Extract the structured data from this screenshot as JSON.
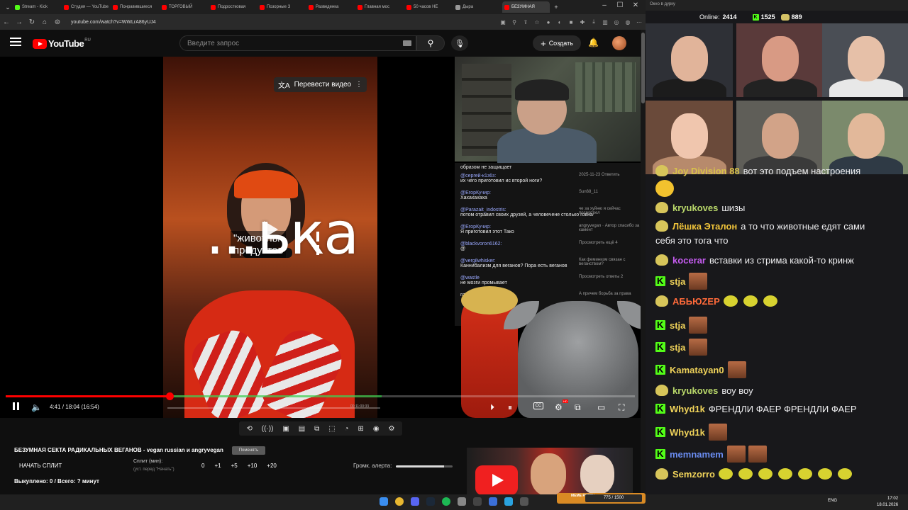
{
  "browser": {
    "tabs": [
      {
        "label": "Stream - Kick",
        "color": "#53fc18",
        "active": false
      },
      {
        "label": "Студия — YouTube",
        "color": "#ff0000",
        "active": false
      },
      {
        "label": "Понравившиеся",
        "color": "#ff0000",
        "active": false
      },
      {
        "label": "ТОРГОВЫЙ",
        "color": "#ff0000",
        "active": false
      },
      {
        "label": "Подростковая",
        "color": "#ff0000",
        "active": false
      },
      {
        "label": "Позорные З",
        "color": "#ff0000",
        "active": false
      },
      {
        "label": "Разведенка",
        "color": "#ff0000",
        "active": false
      },
      {
        "label": "Главная мос",
        "color": "#ff0000",
        "active": false
      },
      {
        "label": "50 часов НЕ",
        "color": "#ff0000",
        "active": false
      },
      {
        "label": "Дыра",
        "color": "#999999",
        "active": false
      },
      {
        "label": "БЕЗУМНАЯ",
        "color": "#ff0000",
        "active": true
      }
    ],
    "url": "youtube.com/watch?v=WWLrA86yUJ4"
  },
  "youtube": {
    "logo_text": "YouTube",
    "region": "RU",
    "search_placeholder": "Введите запрос",
    "create_label": "Создать"
  },
  "video": {
    "translate_label": "Перевести видео",
    "big_caption": "...ька",
    "sub_caption_1": "\"животны",
    "sub_caption_2": "продуктов",
    "time": "4:41 / 18:04 (16:54)",
    "mini_time": "00:11:00:33",
    "progress": 0.26,
    "comments": [
      {
        "author": "",
        "text": "образом не защищает",
        "reply": ""
      },
      {
        "author": "@сергей-к1з6з:",
        "text": "их чего приготовил ис второй ноги?",
        "reply": "2025-11-23 Ответить"
      },
      {
        "author": "@ЕгорКучир:",
        "text": "Хахахахаха",
        "reply": "Sun68_11"
      },
      {
        "author": "@Parazait_indostris:",
        "text": "потом отравил своих друзей, а человечене столько говна",
        "reply": "че за хуйню я сейчас посмотрел"
      },
      {
        "author": "@ЕгорКучир:",
        "text": "Я приготовил этот Тако",
        "reply": "angryvegan · Автор спасибо за камент"
      },
      {
        "author": "@blackvoron6162:",
        "text": "@",
        "reply": "Просмотреть ещё 4"
      },
      {
        "author": "@vergilwhisker:",
        "text": "Каннибализм для веганов? Пора есть веганов",
        "reply": "Как феминизм связан с веганством?"
      },
      {
        "author": "@wastle",
        "text": "не мозги промывает",
        "reply": "Просмотреть ответы 2"
      },
      {
        "author": "",
        "text": "гласи",
        "reply": "А причем борьба за права"
      }
    ]
  },
  "below_video": {
    "title": "БЕЗУМНАЯ СЕКТА РАДИКАЛЬНЫХ ВЕГАНОВ - vegan russian и angryvegan",
    "title_tag": "Поменять",
    "split_button": "НАЧАТЬ СПЛИТ",
    "split_label": "Сплит (мин):",
    "split_sub": "(уст. перед \"Начать\")",
    "split_values": [
      "0",
      "+1",
      "+5",
      "+10",
      "+20"
    ],
    "alert_label": "Громк. алерта:",
    "alert_volume": 0.85,
    "bought": "Выкуплено: 0 / Всего: ? минут"
  },
  "chat_window": {
    "title": "Окно в дурку",
    "online_label": "Online:",
    "online_count": "2414",
    "kick_count": "1525",
    "coin_count": "889",
    "messages": [
      {
        "user": "Joy Division 88",
        "color": "#d8c24a",
        "text": "вот это подъем настроения",
        "badge": "pepe",
        "emotes": 0
      },
      {
        "user": "kryukoves",
        "color": "#b9d86a",
        "text": "шизы",
        "badge": "pepe",
        "emotes": 0
      },
      {
        "user": "Лёшка Эталон",
        "color": "#f0c43a",
        "text": "а то что животные едят сами",
        "badge": "pepe",
        "emotes": 0
      },
      {
        "user": "",
        "color": "#ffffff",
        "text": "себя это тога что",
        "badge": "",
        "emotes": 0
      },
      {
        "user": "kocerar",
        "color": "#c55cf0",
        "text": "вставки из стрима какой-то кринж",
        "badge": "pepe",
        "emotes": 0
      },
      {
        "user": "stja",
        "color": "#f0d35a",
        "text": "",
        "badge": "kick",
        "emotes": 1
      },
      {
        "user": "АБЬЮZEP",
        "color": "#ff6a3a",
        "text": "",
        "badge": "pepe",
        "emotes": 0
      },
      {
        "user": "stja",
        "color": "#f0d35a",
        "text": "",
        "badge": "kick",
        "emotes": 1
      },
      {
        "user": "stja",
        "color": "#f0d35a",
        "text": "",
        "badge": "kick",
        "emotes": 1
      },
      {
        "user": "Kamatayan0",
        "color": "#f0d35a",
        "text": "",
        "badge": "kick",
        "emotes": 1
      },
      {
        "user": "kryukoves",
        "color": "#b9d86a",
        "text": "воу воу",
        "badge": "pepe",
        "emotes": 0
      },
      {
        "user": "Whyd1k",
        "color": "#f0d35a",
        "text": "ФРЕНДЛИ ФАЕР ФРЕНДЛИ ФАЕР",
        "badge": "kick",
        "emotes": 0
      },
      {
        "user": "Whyd1k",
        "color": "#f0d35a",
        "text": "",
        "badge": "kick",
        "emotes": 1
      },
      {
        "user": "memnamem",
        "color": "#6a8cf0",
        "text": "",
        "badge": "kick",
        "emotes": 2
      },
      {
        "user": "Semzorro",
        "color": "#f0d35a",
        "text": "",
        "badge": "pepe",
        "emotes": 0
      }
    ]
  },
  "taskbar": {
    "lang": "ENG",
    "time": "17:02",
    "date": "18.01.2026",
    "meme_label": "MEME PARTY",
    "meme_progress": "775 / 1500"
  }
}
